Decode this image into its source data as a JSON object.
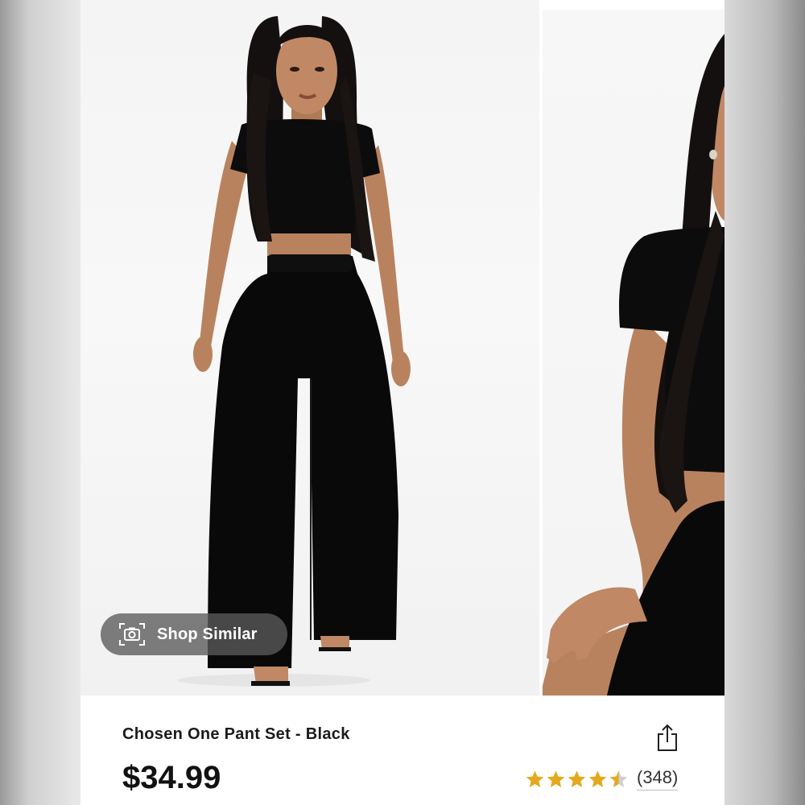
{
  "product": {
    "title": "Chosen One Pant Set - Black",
    "price": "$34.99",
    "rating_value": 4.5,
    "rating_max": 5,
    "review_count": "(348)"
  },
  "gallery": {
    "shop_similar_label": "Shop Similar",
    "shop_similar_icon": "camera-icon",
    "photos": [
      {
        "icon": "product-photo-full-body"
      },
      {
        "icon": "product-photo-closeup"
      }
    ]
  },
  "actions": {
    "share_icon": "share-icon"
  },
  "colors": {
    "star": "#e4a91d",
    "star_empty": "#cfcfcf",
    "button_overlay": "#5a5a5a",
    "text": "#111111"
  }
}
